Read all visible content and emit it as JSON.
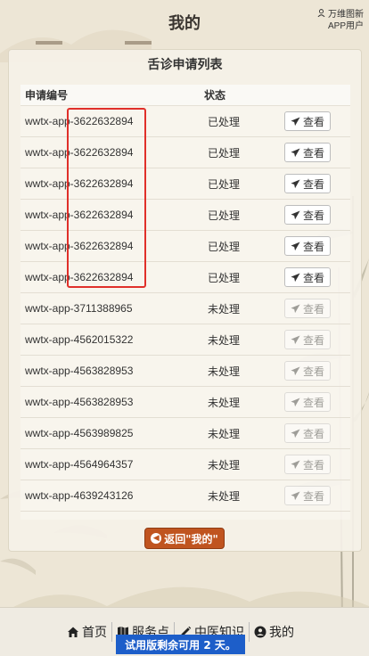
{
  "header": {
    "title": "我的",
    "user_line1": "万维图新",
    "user_line2": "APP用户"
  },
  "panel": {
    "title": "舌诊申请列表",
    "columns": [
      "申请编号",
      "状态"
    ],
    "action_label": "查看",
    "rows": [
      {
        "id": "wwtx-app-3622632894",
        "status": "已处理",
        "viewable": true
      },
      {
        "id": "wwtx-app-3622632894",
        "status": "已处理",
        "viewable": true
      },
      {
        "id": "wwtx-app-3622632894",
        "status": "已处理",
        "viewable": true
      },
      {
        "id": "wwtx-app-3622632894",
        "status": "已处理",
        "viewable": true
      },
      {
        "id": "wwtx-app-3622632894",
        "status": "已处理",
        "viewable": true
      },
      {
        "id": "wwtx-app-3622632894",
        "status": "已处理",
        "viewable": true
      },
      {
        "id": "wwtx-app-3711388965",
        "status": "未处理",
        "viewable": false
      },
      {
        "id": "wwtx-app-4562015322",
        "status": "未处理",
        "viewable": false
      },
      {
        "id": "wwtx-app-4563828953",
        "status": "未处理",
        "viewable": false
      },
      {
        "id": "wwtx-app-4563828953",
        "status": "未处理",
        "viewable": false
      },
      {
        "id": "wwtx-app-4563989825",
        "status": "未处理",
        "viewable": false
      },
      {
        "id": "wwtx-app-4564964357",
        "status": "未处理",
        "viewable": false
      },
      {
        "id": "wwtx-app-4639243126",
        "status": "未处理",
        "viewable": false
      }
    ]
  },
  "back_button": {
    "label": "返回\"我的\"",
    "icon": "arrow-left-circle-icon"
  },
  "bottom_nav": {
    "items": [
      {
        "label": "首页",
        "icon": "home-icon"
      },
      {
        "label": "服务点",
        "icon": "map-icon"
      },
      {
        "label": "中医知识",
        "icon": "pencil-icon"
      },
      {
        "label": "我的",
        "icon": "user-circle-icon"
      }
    ]
  },
  "trial_banner": "试用版剩余可用 2 天。",
  "colors": {
    "accent_back": "#c0541f",
    "banner": "#1d5ec9",
    "highlight": "#e0302a"
  }
}
